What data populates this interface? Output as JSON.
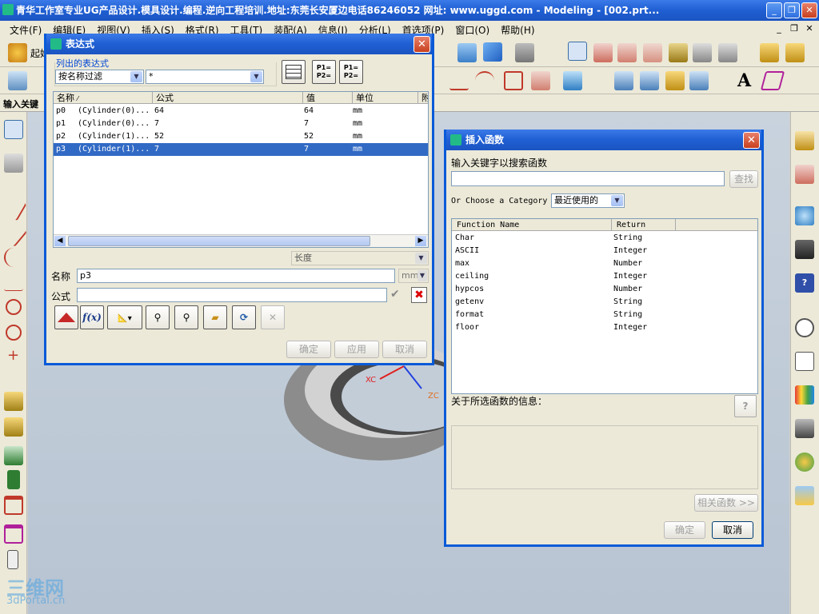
{
  "window": {
    "title": "青华工作室专业UG产品设计.模具设计.编程.逆向工程培训.地址:东莞长安厦边电话86246052 网址: www.uggd.com - Modeling - [002.prt...",
    "min": "_",
    "max": "❐",
    "close": "✕"
  },
  "menubar": {
    "items": [
      "文件(F)",
      "编辑(E)",
      "视图(V)",
      "插入(S)",
      "格式(R)",
      "工具(T)",
      "装配(A)",
      "信息(I)",
      "分析(L)",
      "首选项(P)",
      "窗口(O)",
      "帮助(H)"
    ]
  },
  "toolbar": {
    "start_label": "起始",
    "input_label": "输入关键"
  },
  "expr_dialog": {
    "title": "表达式",
    "group_label": "列出的表达式",
    "filter_value": "按名称过滤",
    "filter_pattern": "*",
    "columns": [
      "名称",
      "公式",
      "值",
      "单位",
      "附"
    ],
    "rows": [
      {
        "name": "p0",
        "source": "(Cylinder(0)...",
        "formula": "64",
        "value": "64",
        "unit": "mm"
      },
      {
        "name": "p1",
        "source": "(Cylinder(0)...",
        "formula": "7",
        "value": "7",
        "unit": "mm"
      },
      {
        "name": "p2",
        "source": "(Cylinder(1)...",
        "formula": "52",
        "value": "52",
        "unit": "mm"
      },
      {
        "name": "p3",
        "source": "(Cylinder(1)...",
        "formula": "7",
        "value": "7",
        "unit": "mm"
      }
    ],
    "selected_row": 3,
    "type_value": "长度",
    "name_label": "名称",
    "name_value": "p3",
    "unit_value": "mm",
    "formula_label": "公式",
    "formula_value": "",
    "fx_label": "f(x)",
    "ok": "确定",
    "apply": "应用",
    "cancel": "取消"
  },
  "func_dialog": {
    "title": "插入函数",
    "search_label": "输入关键字以搜索函数",
    "search_value": "",
    "find_button": "查找",
    "category_label": "Or Choose a Category",
    "category_value": "最近使用的",
    "columns": [
      "Function Name",
      "Return"
    ],
    "functions": [
      {
        "name": "Char",
        "return": "String"
      },
      {
        "name": "ASCII",
        "return": "Integer"
      },
      {
        "name": "max",
        "return": "Number"
      },
      {
        "name": "ceiling",
        "return": "Integer"
      },
      {
        "name": "hypcos",
        "return": "Number"
      },
      {
        "name": "getenv",
        "return": "String"
      },
      {
        "name": "format",
        "return": "String"
      },
      {
        "name": "floor",
        "return": "Integer"
      }
    ],
    "info_label": "关于所选函数的信息：",
    "info_value": "",
    "related_button": "相关函数 >>",
    "ok": "确定",
    "cancel": "取消"
  },
  "graphics": {
    "axis_x_label": "XC",
    "axis_z_label": "ZC"
  },
  "watermark": {
    "text1": "三维网",
    "text2": "3dPortal.cn"
  }
}
